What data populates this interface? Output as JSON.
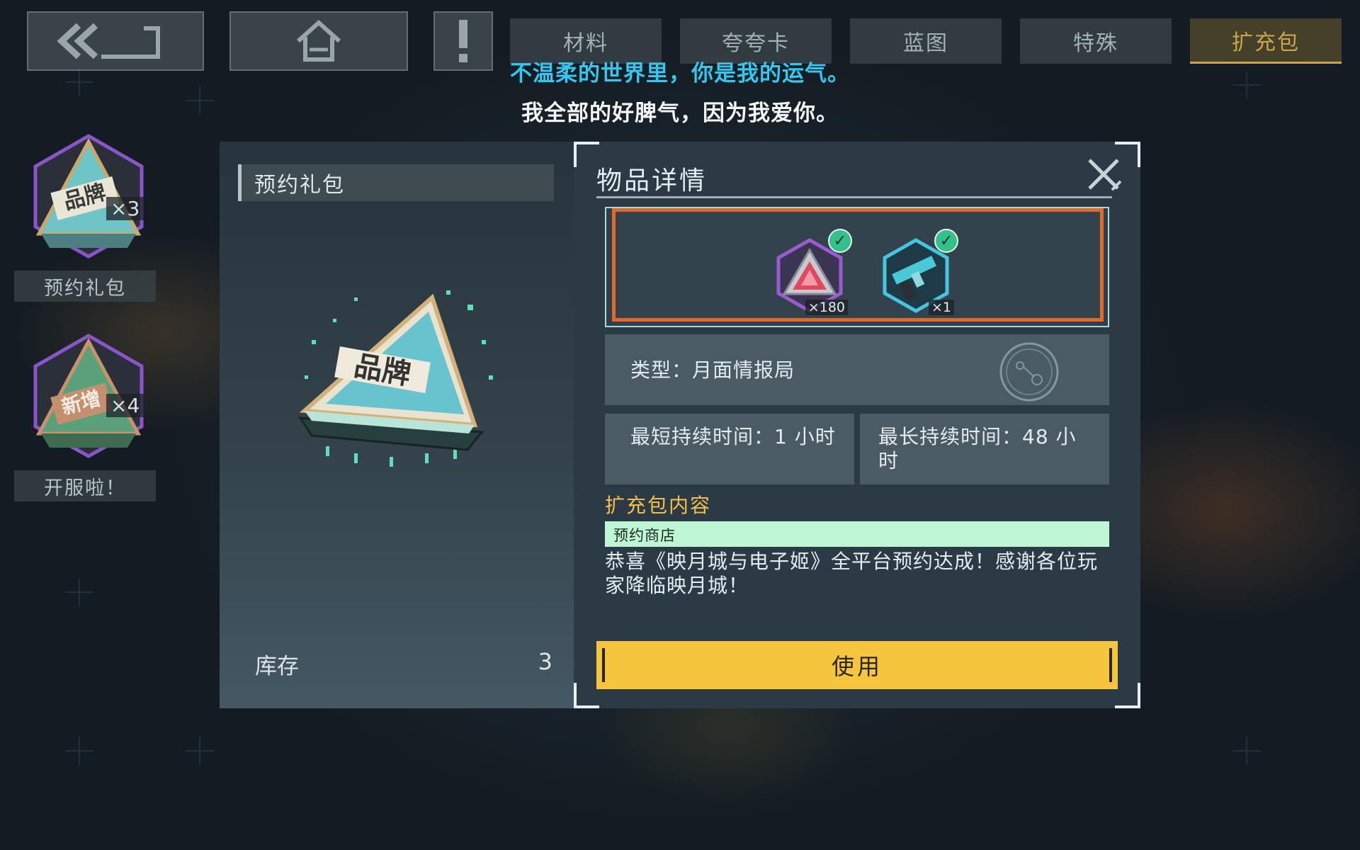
{
  "top_bar": {
    "tabs": [
      {
        "label": "材料"
      },
      {
        "label": "夸夸卡"
      },
      {
        "label": "蓝图"
      },
      {
        "label": "特殊"
      },
      {
        "label": "扩充包"
      }
    ],
    "active_tab": "扩充包",
    "back_icon": "double-chevron-left-icon",
    "home_icon": "home-icon",
    "alert_icon": "exclamation-icon"
  },
  "subtitle": {
    "line1": "不温柔的世界里，你是我的运气。",
    "line2": "我全部的好脾气，因为我爱你。"
  },
  "left_list": {
    "items": [
      {
        "label": "预约礼包",
        "badge_text": "品牌",
        "count": "×3"
      },
      {
        "label": "开服啦！",
        "badge_text": "新增",
        "count": "×4"
      }
    ]
  },
  "pack_panel": {
    "title": "预约礼包",
    "emblem_text": "品牌",
    "stock_label": "库存",
    "stock_value": "3"
  },
  "detail": {
    "title": "物品详情",
    "rewards": [
      {
        "qty": "×180",
        "icon": "red-crystal-icon"
      },
      {
        "qty": "×1",
        "icon": "cyan-blaster-gun-icon"
      }
    ],
    "type_text": "类型：月面情报局",
    "type_icon": "moon-globe-icon",
    "min_duration": "最短持续时间：1 小时",
    "max_duration": "最长持续时间：48 小时",
    "section_title": "扩充包内容",
    "store_label": "预约商店",
    "description": "恭喜《映月城与电子姬》全平台预约达成！感谢各位玩家降临映月城！",
    "use_button": "使用"
  },
  "colors": {
    "accent_gold": "#f6c53e",
    "subtitle_blue": "#35c7ef",
    "reward_border": "#e06a2b",
    "store_bar": "#bff6d5"
  }
}
